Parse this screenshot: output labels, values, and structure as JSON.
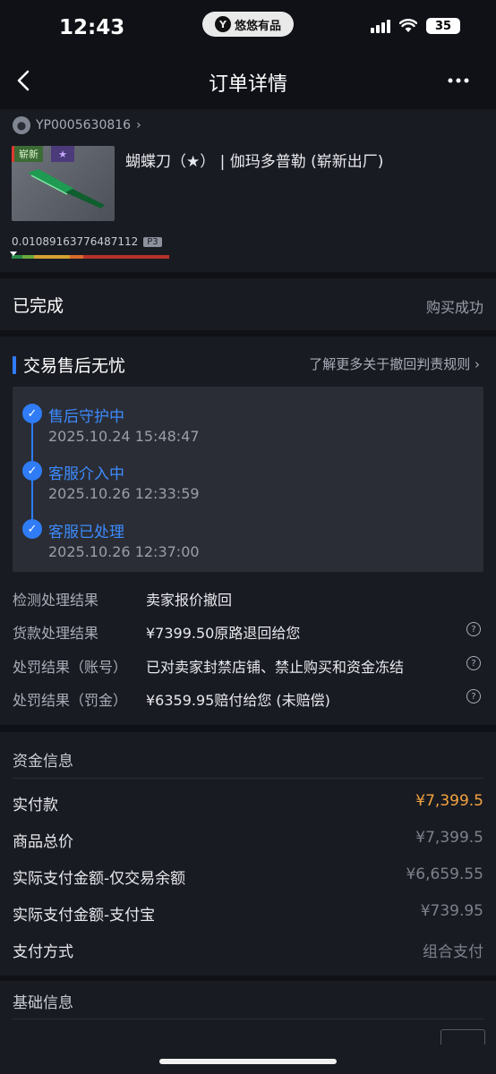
{
  "status_bar": {
    "time": "12:43",
    "app_pill": "悠悠有品",
    "battery": "35"
  },
  "nav": {
    "title": "订单详情",
    "back_icon": "chevron-left-icon",
    "more_icon": "more-dots-icon"
  },
  "item": {
    "seller_id": "YP0005630816",
    "wear_tag": "崭新",
    "star_tag": "★",
    "name": "蝴蝶刀（★） | 伽玛多普勒 (崭新出厂)",
    "float_value": "0.01089163776487112",
    "phase_tag": "P3",
    "wear_fraction": 0.0109
  },
  "order_status": {
    "state": "已完成",
    "result": "购买成功"
  },
  "after_sales": {
    "title": "交易售后无忧",
    "learn_more": "了解更多关于撤回判责规则",
    "timeline": [
      {
        "title": "售后守护中",
        "time": "2025.10.24 15:48:47"
      },
      {
        "title": "客服介入中",
        "time": "2025.10.26 12:33:59"
      },
      {
        "title": "客服已处理",
        "time": "2025.10.26 12:37:00"
      }
    ],
    "results": [
      {
        "label": "检测处理结果",
        "value": "卖家报价撤回"
      },
      {
        "label": "货款处理结果",
        "value": "¥7399.50原路退回给您"
      },
      {
        "label": "处罚结果（账号）",
        "value": "已对卖家封禁店铺、禁止购买和资金冻结"
      },
      {
        "label": "处罚结果（罚金）",
        "value": "¥6359.95赔付给您 (未赔偿)"
      }
    ]
  },
  "funds": {
    "title": "资金信息",
    "rows": [
      {
        "label": "实付款",
        "value": "¥7,399.5"
      },
      {
        "label": "商品总价",
        "value": "¥7,399.5"
      },
      {
        "label": "实际支付金额-仅交易余额",
        "value": "¥6,659.55"
      },
      {
        "label": "实际支付金额-支付宝",
        "value": "¥739.95"
      },
      {
        "label": "支付方式",
        "value": "组合支付"
      }
    ]
  },
  "basic": {
    "title": "基础信息"
  },
  "colors": {
    "background": "#0f1117",
    "card": "#191b22",
    "accent_blue": "#2f7cf6",
    "accent_orange": "#f4a340"
  }
}
